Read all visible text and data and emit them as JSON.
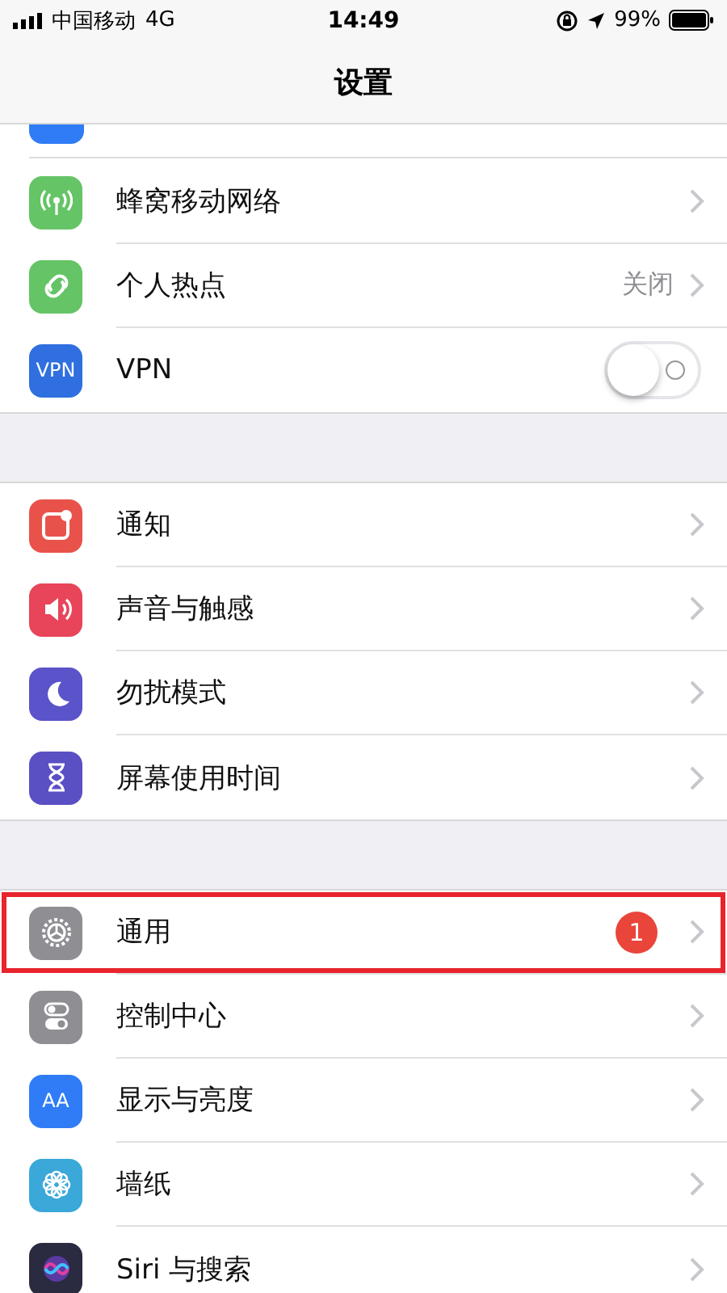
{
  "status_bar": {
    "carrier": "中国移动",
    "network": "4G",
    "time": "14:49",
    "battery": "99%"
  },
  "nav": {
    "title": "设置"
  },
  "partial_row": {
    "color": "#2f7cf6"
  },
  "groups": [
    {
      "rows": [
        {
          "kind": "link",
          "label": "蜂窝移动网络",
          "color": "#65c466",
          "highlighted": false
        },
        {
          "kind": "value",
          "label": "个人热点",
          "value": "关闭",
          "color": "#65c466",
          "highlighted": false
        },
        {
          "kind": "toggle",
          "label": "VPN",
          "icon_text": "VPN",
          "on": false,
          "color": "#2f6fdf",
          "highlighted": false
        }
      ]
    },
    {
      "rows": [
        {
          "kind": "link",
          "label": "通知",
          "color": "#e9524a",
          "highlighted": false
        },
        {
          "kind": "link",
          "label": "声音与触感",
          "color": "#e8445a",
          "highlighted": false
        },
        {
          "kind": "link",
          "label": "勿扰模式",
          "color": "#5b53c9",
          "highlighted": false
        },
        {
          "kind": "link",
          "label": "屏幕使用时间",
          "color": "#5b4fc4",
          "highlighted": false
        }
      ]
    },
    {
      "rows": [
        {
          "kind": "link",
          "label": "通用",
          "badge": "1",
          "color": "#8e8e93",
          "highlighted": true
        },
        {
          "kind": "link",
          "label": "控制中心",
          "color": "#8e8e93",
          "highlighted": false
        },
        {
          "kind": "link",
          "label": "显示与亮度",
          "icon_text": "AA",
          "color": "#2f7cf6",
          "highlighted": false
        },
        {
          "kind": "link",
          "label": "墙纸",
          "color": "#3aa8d8",
          "highlighted": false
        },
        {
          "kind": "link",
          "label": "Siri 与搜索",
          "color": "#2a2a40",
          "highlighted": false
        }
      ]
    }
  ]
}
